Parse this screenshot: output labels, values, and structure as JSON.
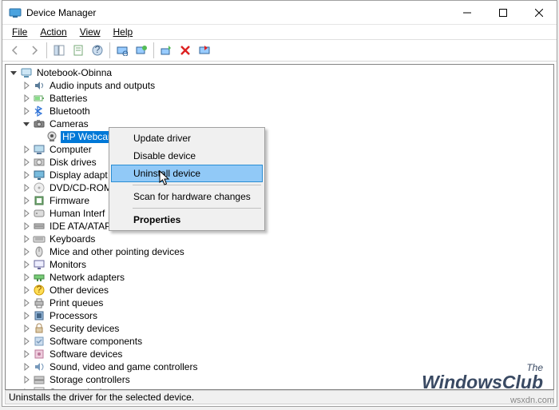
{
  "title": "Device Manager",
  "menu": {
    "file": "File",
    "action": "Action",
    "view": "View",
    "help": "Help"
  },
  "status": "Uninstalls the driver for the selected device.",
  "root": "Notebook-Obinna",
  "nodes": [
    {
      "label": "Audio inputs and outputs",
      "icon": "audio"
    },
    {
      "label": "Batteries",
      "icon": "battery"
    },
    {
      "label": "Bluetooth",
      "icon": "bt"
    },
    {
      "label": "Cameras",
      "icon": "camera",
      "expanded": true,
      "children": [
        {
          "label": "HP Webcam",
          "icon": "webcam",
          "selected": true
        }
      ]
    },
    {
      "label": "Computer",
      "icon": "computer"
    },
    {
      "label": "Disk drives",
      "icon": "disk"
    },
    {
      "label": "Display adapt",
      "icon": "display",
      "truncated": true
    },
    {
      "label": "DVD/CD-ROM",
      "icon": "dvd",
      "truncated": true
    },
    {
      "label": "Firmware",
      "icon": "firmware"
    },
    {
      "label": "Human Interf",
      "icon": "hid",
      "truncated": true
    },
    {
      "label": "IDE ATA/ATAP.",
      "icon": "ide",
      "truncated": true
    },
    {
      "label": "Keyboards",
      "icon": "keyboard"
    },
    {
      "label": "Mice and other pointing devices",
      "icon": "mouse"
    },
    {
      "label": "Monitors",
      "icon": "monitor"
    },
    {
      "label": "Network adapters",
      "icon": "network"
    },
    {
      "label": "Other devices",
      "icon": "other"
    },
    {
      "label": "Print queues",
      "icon": "printer"
    },
    {
      "label": "Processors",
      "icon": "cpu"
    },
    {
      "label": "Security devices",
      "icon": "security"
    },
    {
      "label": "Software components",
      "icon": "swcomp"
    },
    {
      "label": "Software devices",
      "icon": "swdev"
    },
    {
      "label": "Sound, video and game controllers",
      "icon": "sound"
    },
    {
      "label": "Storage controllers",
      "icon": "storage"
    },
    {
      "label": "System devices",
      "icon": "system",
      "cutoff": true
    }
  ],
  "context": {
    "items": [
      {
        "label": "Update driver"
      },
      {
        "label": "Disable device"
      },
      {
        "label": "Uninstall device",
        "hover": true
      },
      {
        "sep": true
      },
      {
        "label": "Scan for hardware changes"
      },
      {
        "sep": true
      },
      {
        "label": "Properties",
        "bold": true
      }
    ]
  },
  "watermark": {
    "line1": "The",
    "line2": "WindowsClub",
    "site": "wsxdn.com"
  }
}
